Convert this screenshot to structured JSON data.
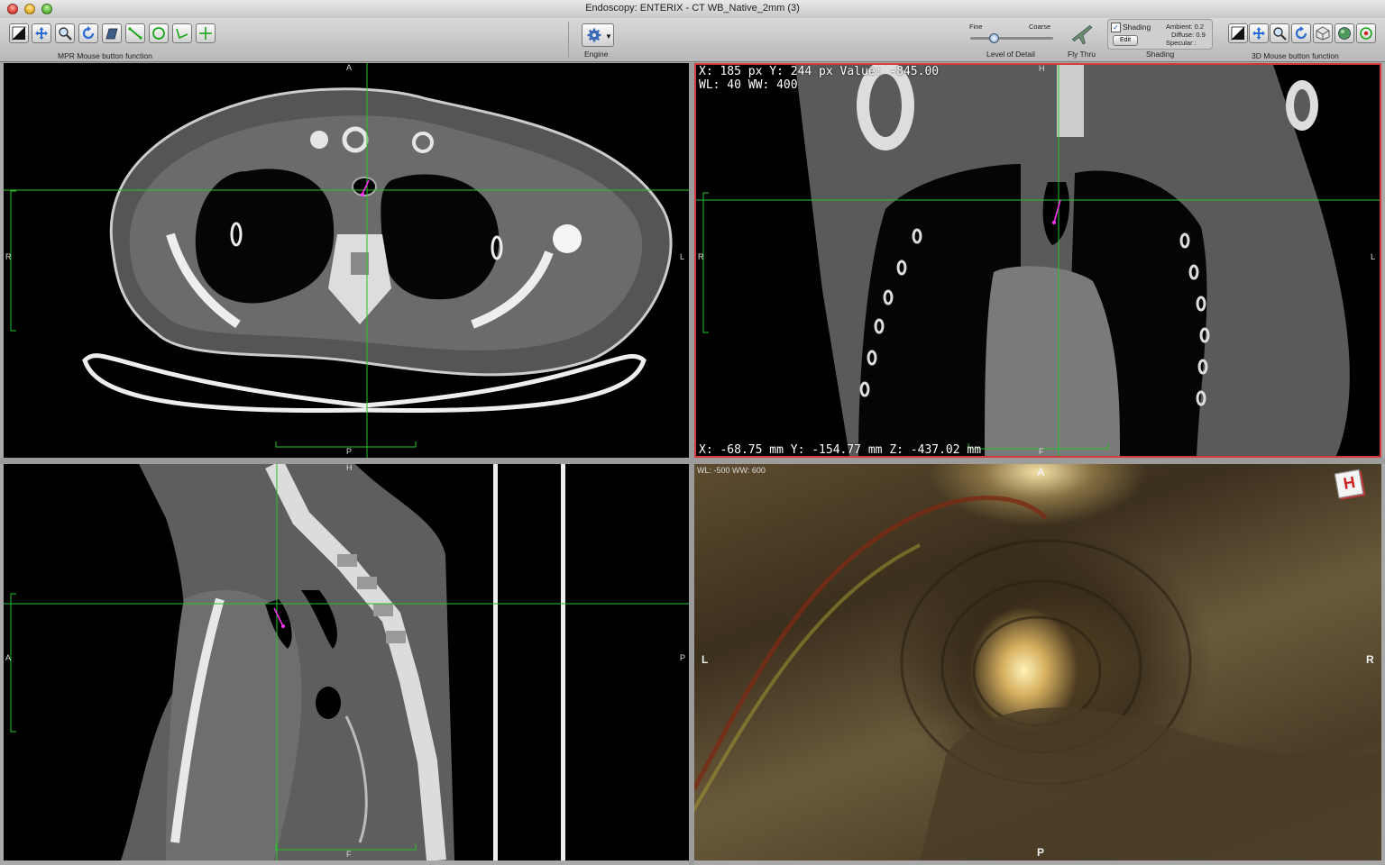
{
  "window": {
    "title": "Endoscopy: ENTERIX - CT WB_Native_2mm (3)"
  },
  "toolbar": {
    "mpr_caption": "MPR Mouse button function",
    "engine_caption": "Engine",
    "lod_caption": "Level of Detail",
    "lod_fine": "Fine",
    "lod_coarse": "Coarse",
    "lod_value": 0.25,
    "flythru_caption": "Fly Thru",
    "shading_caption": "Shading",
    "shading_label": "Shading",
    "shading_checked": true,
    "shading_edit": "Edit",
    "ambient": "Ambient: 0.2",
    "diffuse": "Diffuse: 0.9",
    "specular": "Specular :",
    "mouse3d_caption": "3D Mouse button function",
    "mpr_tools": [
      "window-level-icon",
      "move-icon",
      "zoom-icon",
      "rotate-icon",
      "slab-icon",
      "measure-line-icon",
      "roi-circle-icon",
      "angle-icon",
      "crosshair-plus-icon"
    ],
    "tools3d": [
      "window-level-icon",
      "move-icon",
      "zoom-icon",
      "rotate-icon",
      "volume-cube-icon",
      "sphere-icon",
      "target-icon"
    ]
  },
  "colors": {
    "crosshair": "#27c427",
    "selected_border": "#d43a3a",
    "path": "#ff33ff"
  },
  "axial": {
    "top": "A",
    "bottom": "P",
    "left": "R",
    "right": "L"
  },
  "coronal": {
    "info_line1": "X: 185 px Y: 244 px Value: -845.00",
    "info_line2": "WL: 40 WW: 400",
    "coords": "X: -68.75 mm Y: -154.77 mm Z: -437.02 mm",
    "top": "H",
    "bottom": "F",
    "left": "R",
    "right": "L"
  },
  "sagittal": {
    "top": "H",
    "bottom": "F",
    "left": "A",
    "right": "P"
  },
  "endo3d": {
    "wlww": "WL: -500 WW: 600",
    "top": "A",
    "bottom": "P",
    "left": "L",
    "right": "R",
    "cube_label": "H"
  }
}
